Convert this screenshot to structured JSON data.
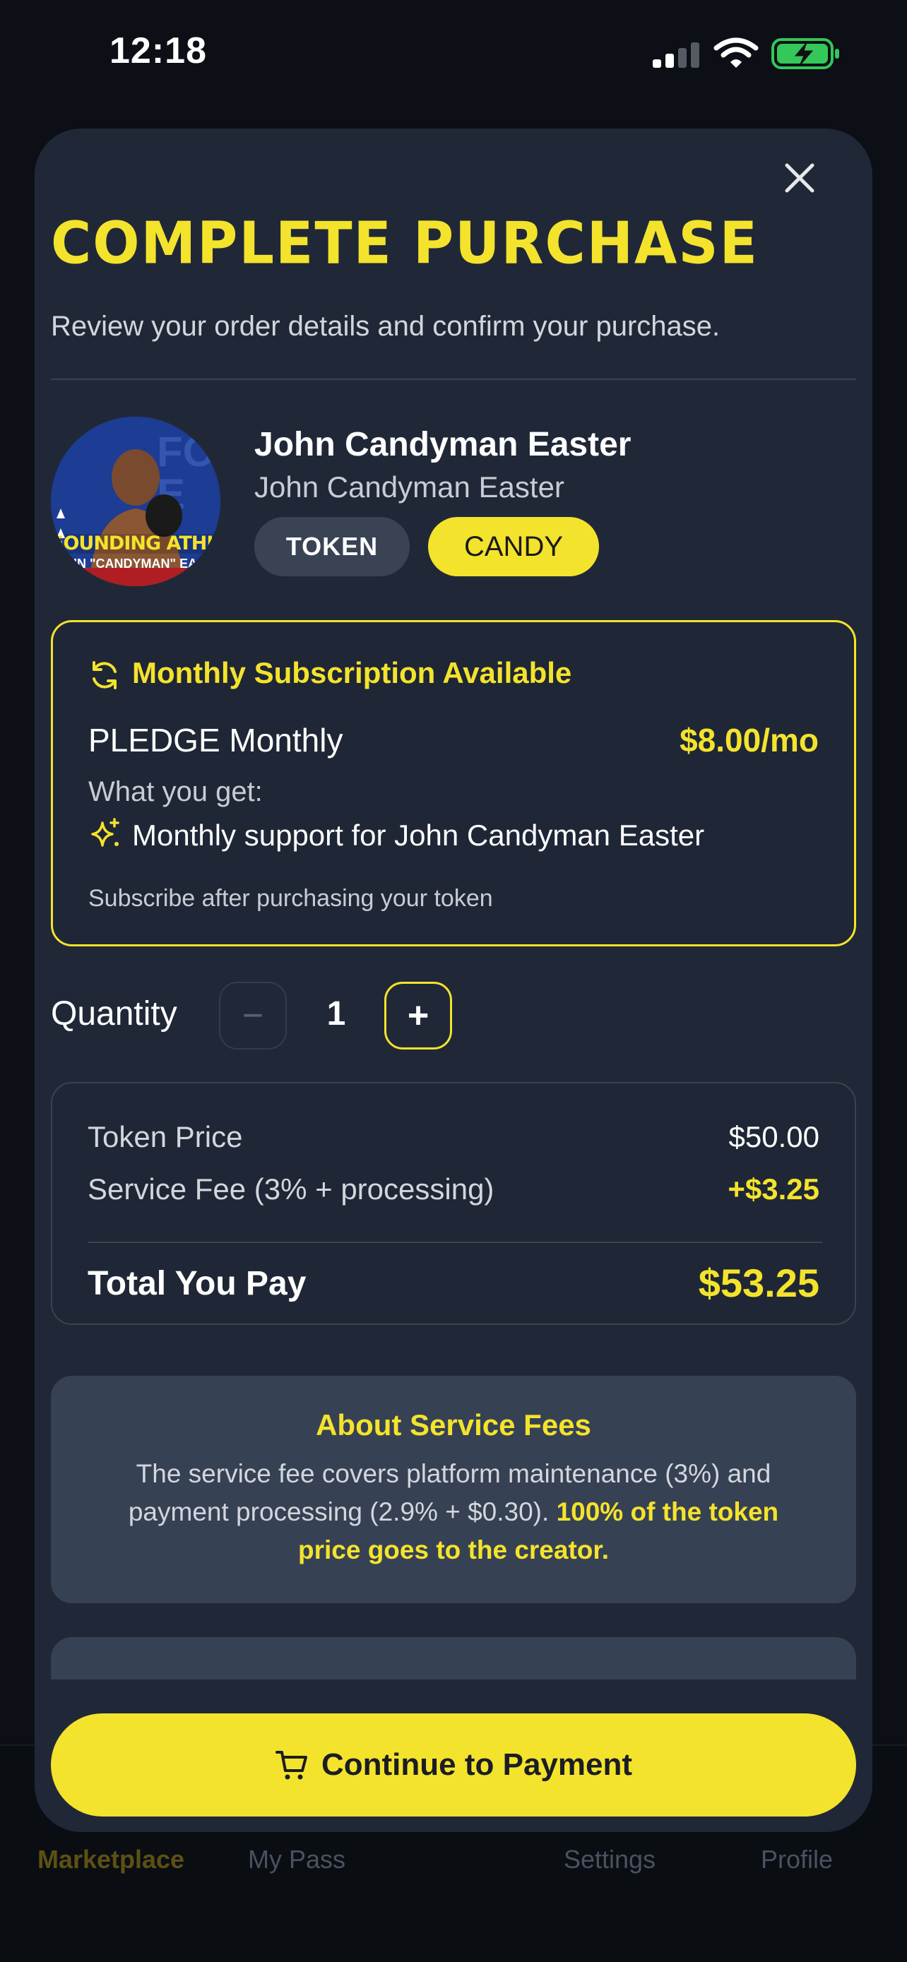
{
  "status_bar": {
    "time": "12:18"
  },
  "tab_bar": {
    "items": [
      {
        "label": "Marketplace"
      },
      {
        "label": "My Pass"
      },
      {
        "label": "Settings"
      },
      {
        "label": "Profile"
      }
    ]
  },
  "sheet": {
    "title": "COMPLETE PURCHASE",
    "subtitle": "Review your order details and confirm your purchase."
  },
  "creator": {
    "name": "John Candyman Easter",
    "subtitle": "John Candyman Easter",
    "avatar_text": [
      "FOUNDING ATHLETE",
      "JOHN \"CANDYMAN\" EASTER"
    ],
    "tags": [
      "TOKEN",
      "CANDY"
    ]
  },
  "subscription": {
    "header": "Monthly Subscription Available",
    "plan": "PLEDGE Monthly",
    "price": "$8.00/mo",
    "what_you_get": "What you get:",
    "benefit": "Monthly support for John Candyman Easter",
    "note": "Subscribe after purchasing your token"
  },
  "quantity": {
    "label": "Quantity",
    "minus": "−",
    "value": "1",
    "plus": "+"
  },
  "pricing": {
    "token_price_label": "Token Price",
    "token_price_value": "$50.00",
    "service_fee_label": "Service Fee (3% + processing)",
    "service_fee_value": "+$3.25",
    "total_label": "Total You Pay",
    "total_value": "$53.25"
  },
  "fees_info": {
    "title": "About Service Fees",
    "text": "The service fee covers platform maintenance (3%) and payment processing (2.9% + $0.30). ",
    "highlight": "100% of the token price goes to the creator."
  },
  "cta": {
    "label": "Continue to Payment"
  },
  "colors": {
    "accent": "#f4e32c",
    "sheet_bg": "#202838",
    "page_bg": "#0c0f15",
    "battery": "#34c759"
  }
}
